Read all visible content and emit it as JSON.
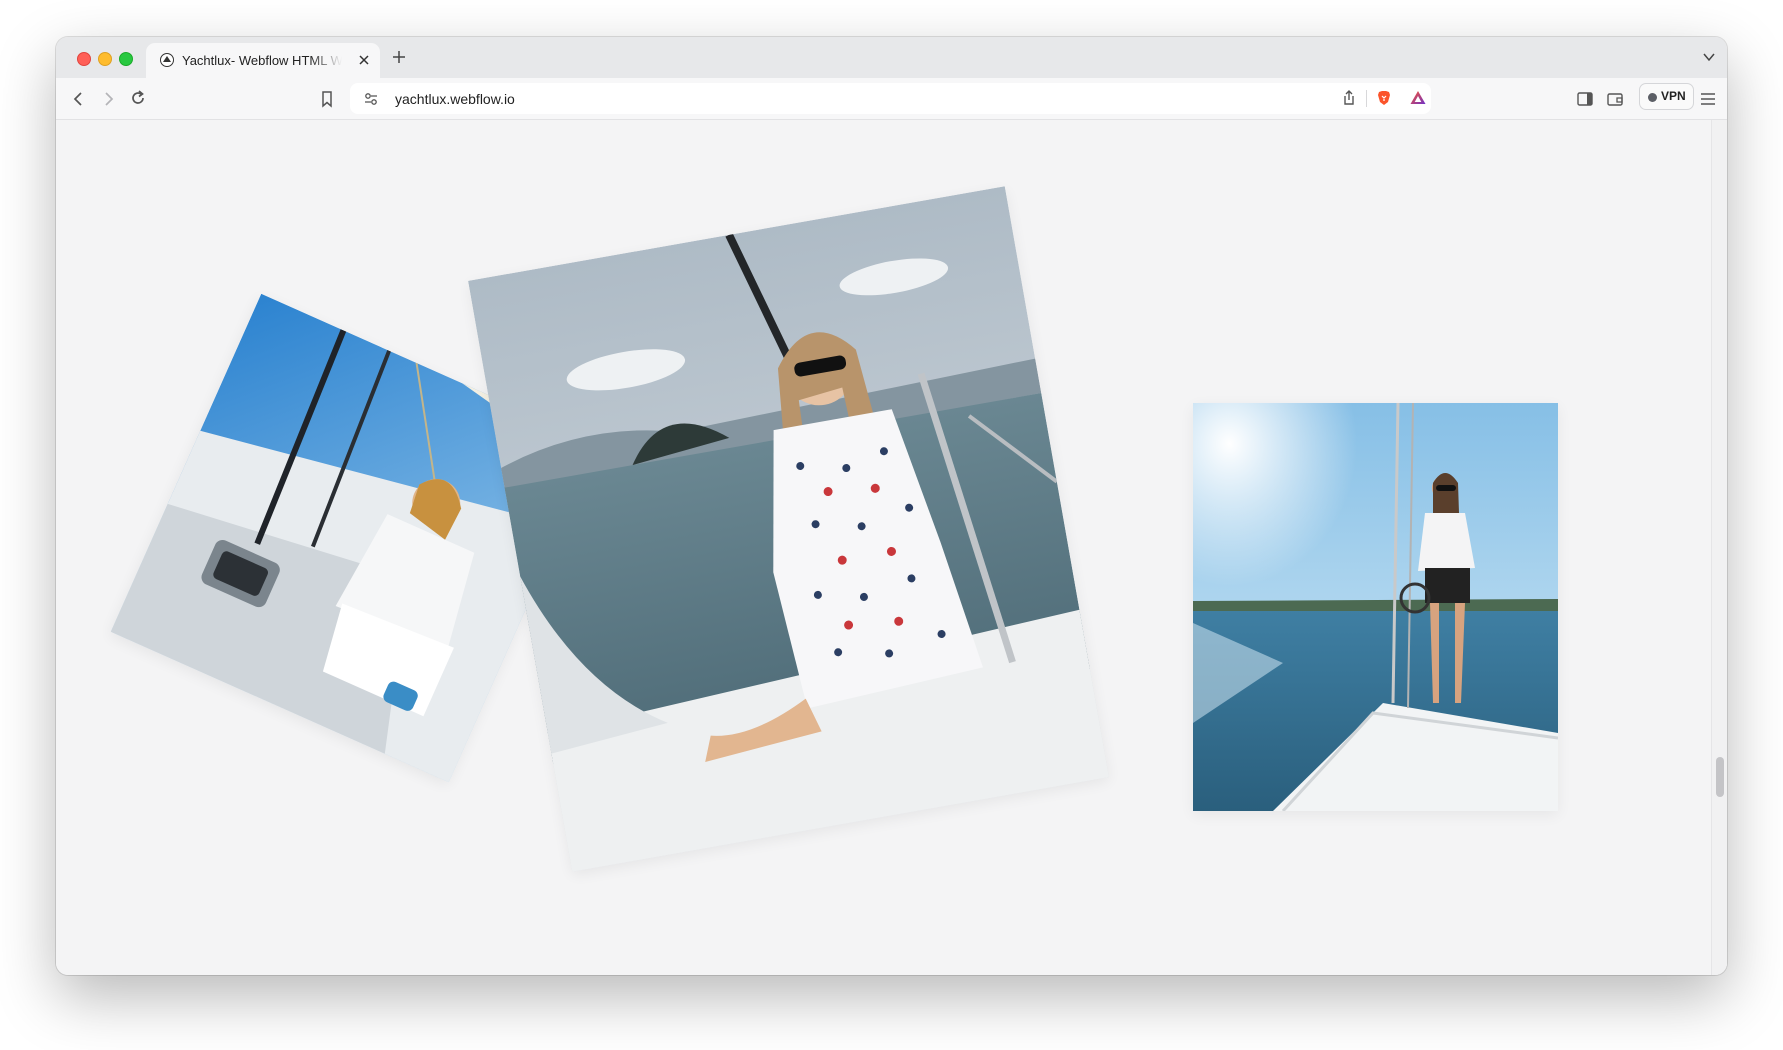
{
  "browser": {
    "tab": {
      "title": "Yachtlux- Webflow HTML Website Template",
      "favicon": "webflow-favicon-icon"
    },
    "address_bar": {
      "url": "yachtlux.webflow.io"
    },
    "toolbar": {
      "vpn_label": "VPN"
    }
  },
  "page": {
    "gallery": [
      {
        "name": "photo-left",
        "description_icon": "woman-on-sailboat-photo"
      },
      {
        "name": "photo-center",
        "description_icon": "woman-in-anchor-dress-photo"
      },
      {
        "name": "photo-right",
        "description_icon": "woman-on-yacht-bow-photo"
      }
    ]
  },
  "colors": {
    "page_bg": "#f4f4f5",
    "tabstrip_bg": "#e7e8ea",
    "brave_orange": "#fb542b"
  }
}
